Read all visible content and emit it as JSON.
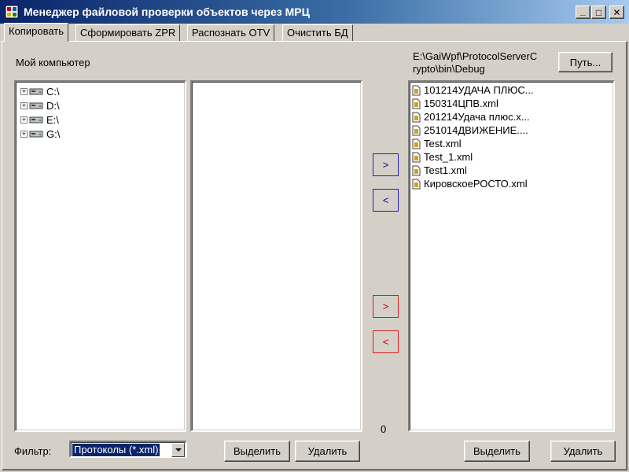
{
  "window": {
    "title": "Менеджер файловой проверки объектов через МРЦ",
    "min_label": "_",
    "max_label": "□",
    "close_label": "✕"
  },
  "tabs": [
    {
      "label": "Копировать",
      "active": true
    },
    {
      "label": "Сформировать ZPR",
      "active": false
    },
    {
      "label": "Распознать OTV",
      "active": false
    },
    {
      "label": "Очистить БД",
      "active": false
    }
  ],
  "left": {
    "heading": "Мой компьютер",
    "drives": [
      {
        "label": "C:\\",
        "icon": "drive-icon"
      },
      {
        "label": "D:\\",
        "icon": "drive-icon"
      },
      {
        "label": "E:\\",
        "icon": "drive-icon"
      },
      {
        "label": "G:\\",
        "icon": "drive-icon"
      }
    ]
  },
  "right": {
    "path_line1": "E:\\GaiWpf\\ProtocolServerC",
    "path_line2": "rypto\\bin\\Debug",
    "path_button": "Путь...",
    "files": [
      "101214УДАЧА ПЛЮС...",
      "150314ЦПВ.xml",
      "201214Удача плюс.x...",
      "251014ДВИЖЕНИЕ....",
      "Test.xml",
      "Test_1.xml",
      "Test1.xml",
      "КировскоеРОСТО.xml"
    ]
  },
  "arrows": {
    "blue_right": ">",
    "blue_left": "<",
    "red_right": ">",
    "red_left": "<"
  },
  "counter": "0",
  "bottom": {
    "filter_label": "Фильтр:",
    "filter_value": "Протоколы (*.xml)",
    "select_button": "Выделить",
    "delete_button": "Удалить",
    "select_button_right": "Выделить",
    "delete_button_right": "Удалить"
  },
  "colors": {
    "title_gradient_start": "#0a246a",
    "title_gradient_end": "#a6caf0",
    "face": "#d4d0c8",
    "blue_arrow": "#0000c0",
    "red_arrow": "#c00000"
  }
}
